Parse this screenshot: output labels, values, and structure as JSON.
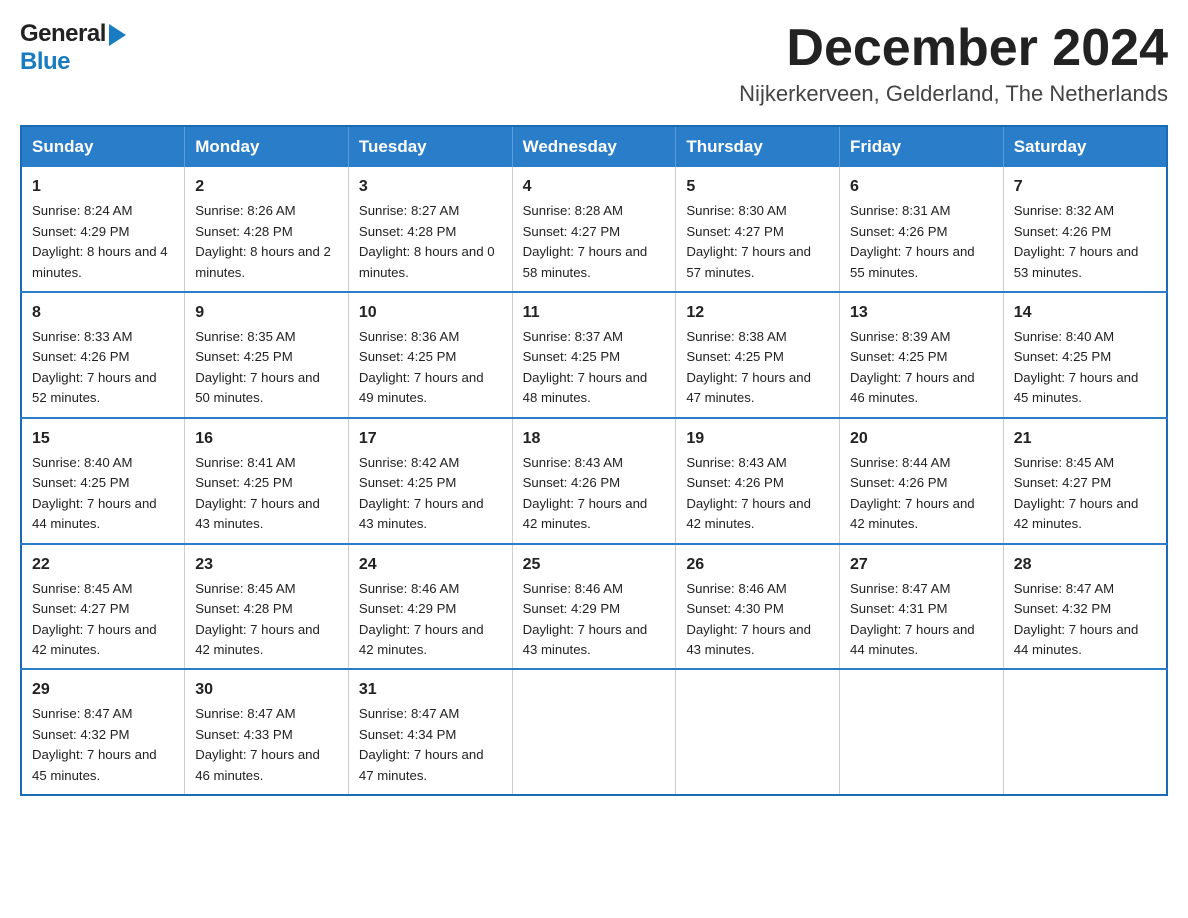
{
  "header": {
    "logo_general": "General",
    "logo_blue": "Blue",
    "month_title": "December 2024",
    "location": "Nijkerkerveen, Gelderland, The Netherlands"
  },
  "weekdays": [
    "Sunday",
    "Monday",
    "Tuesday",
    "Wednesday",
    "Thursday",
    "Friday",
    "Saturday"
  ],
  "weeks": [
    [
      {
        "day": "1",
        "sunrise": "8:24 AM",
        "sunset": "4:29 PM",
        "daylight": "8 hours and 4 minutes."
      },
      {
        "day": "2",
        "sunrise": "8:26 AM",
        "sunset": "4:28 PM",
        "daylight": "8 hours and 2 minutes."
      },
      {
        "day": "3",
        "sunrise": "8:27 AM",
        "sunset": "4:28 PM",
        "daylight": "8 hours and 0 minutes."
      },
      {
        "day": "4",
        "sunrise": "8:28 AM",
        "sunset": "4:27 PM",
        "daylight": "7 hours and 58 minutes."
      },
      {
        "day": "5",
        "sunrise": "8:30 AM",
        "sunset": "4:27 PM",
        "daylight": "7 hours and 57 minutes."
      },
      {
        "day": "6",
        "sunrise": "8:31 AM",
        "sunset": "4:26 PM",
        "daylight": "7 hours and 55 minutes."
      },
      {
        "day": "7",
        "sunrise": "8:32 AM",
        "sunset": "4:26 PM",
        "daylight": "7 hours and 53 minutes."
      }
    ],
    [
      {
        "day": "8",
        "sunrise": "8:33 AM",
        "sunset": "4:26 PM",
        "daylight": "7 hours and 52 minutes."
      },
      {
        "day": "9",
        "sunrise": "8:35 AM",
        "sunset": "4:25 PM",
        "daylight": "7 hours and 50 minutes."
      },
      {
        "day": "10",
        "sunrise": "8:36 AM",
        "sunset": "4:25 PM",
        "daylight": "7 hours and 49 minutes."
      },
      {
        "day": "11",
        "sunrise": "8:37 AM",
        "sunset": "4:25 PM",
        "daylight": "7 hours and 48 minutes."
      },
      {
        "day": "12",
        "sunrise": "8:38 AM",
        "sunset": "4:25 PM",
        "daylight": "7 hours and 47 minutes."
      },
      {
        "day": "13",
        "sunrise": "8:39 AM",
        "sunset": "4:25 PM",
        "daylight": "7 hours and 46 minutes."
      },
      {
        "day": "14",
        "sunrise": "8:40 AM",
        "sunset": "4:25 PM",
        "daylight": "7 hours and 45 minutes."
      }
    ],
    [
      {
        "day": "15",
        "sunrise": "8:40 AM",
        "sunset": "4:25 PM",
        "daylight": "7 hours and 44 minutes."
      },
      {
        "day": "16",
        "sunrise": "8:41 AM",
        "sunset": "4:25 PM",
        "daylight": "7 hours and 43 minutes."
      },
      {
        "day": "17",
        "sunrise": "8:42 AM",
        "sunset": "4:25 PM",
        "daylight": "7 hours and 43 minutes."
      },
      {
        "day": "18",
        "sunrise": "8:43 AM",
        "sunset": "4:26 PM",
        "daylight": "7 hours and 42 minutes."
      },
      {
        "day": "19",
        "sunrise": "8:43 AM",
        "sunset": "4:26 PM",
        "daylight": "7 hours and 42 minutes."
      },
      {
        "day": "20",
        "sunrise": "8:44 AM",
        "sunset": "4:26 PM",
        "daylight": "7 hours and 42 minutes."
      },
      {
        "day": "21",
        "sunrise": "8:45 AM",
        "sunset": "4:27 PM",
        "daylight": "7 hours and 42 minutes."
      }
    ],
    [
      {
        "day": "22",
        "sunrise": "8:45 AM",
        "sunset": "4:27 PM",
        "daylight": "7 hours and 42 minutes."
      },
      {
        "day": "23",
        "sunrise": "8:45 AM",
        "sunset": "4:28 PM",
        "daylight": "7 hours and 42 minutes."
      },
      {
        "day": "24",
        "sunrise": "8:46 AM",
        "sunset": "4:29 PM",
        "daylight": "7 hours and 42 minutes."
      },
      {
        "day": "25",
        "sunrise": "8:46 AM",
        "sunset": "4:29 PM",
        "daylight": "7 hours and 43 minutes."
      },
      {
        "day": "26",
        "sunrise": "8:46 AM",
        "sunset": "4:30 PM",
        "daylight": "7 hours and 43 minutes."
      },
      {
        "day": "27",
        "sunrise": "8:47 AM",
        "sunset": "4:31 PM",
        "daylight": "7 hours and 44 minutes."
      },
      {
        "day": "28",
        "sunrise": "8:47 AM",
        "sunset": "4:32 PM",
        "daylight": "7 hours and 44 minutes."
      }
    ],
    [
      {
        "day": "29",
        "sunrise": "8:47 AM",
        "sunset": "4:32 PM",
        "daylight": "7 hours and 45 minutes."
      },
      {
        "day": "30",
        "sunrise": "8:47 AM",
        "sunset": "4:33 PM",
        "daylight": "7 hours and 46 minutes."
      },
      {
        "day": "31",
        "sunrise": "8:47 AM",
        "sunset": "4:34 PM",
        "daylight": "7 hours and 47 minutes."
      },
      null,
      null,
      null,
      null
    ]
  ]
}
